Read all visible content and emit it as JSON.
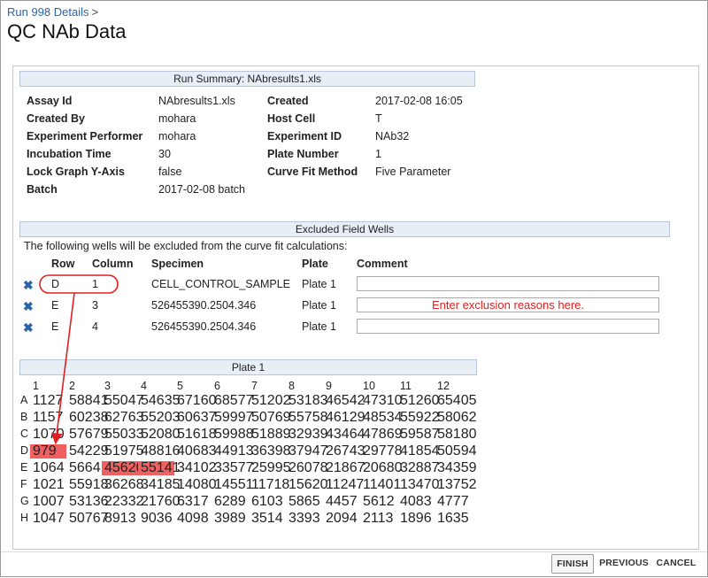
{
  "breadcrumb": {
    "label": "Run 998 Details",
    "sep": ">"
  },
  "page": {
    "title": "QC NAb Data"
  },
  "run_summary": {
    "title": "Run Summary: NAbresults1.xls",
    "left": [
      {
        "key": "Assay Id",
        "value": "NAbresults1.xls"
      },
      {
        "key": "Created By",
        "value": "mohara"
      },
      {
        "key": "Experiment Performer",
        "value": "mohara"
      },
      {
        "key": "Incubation Time",
        "value": "30"
      },
      {
        "key": "Lock Graph Y-Axis",
        "value": "false"
      },
      {
        "key": "Batch",
        "value": "2017-02-08 batch"
      }
    ],
    "right": [
      {
        "key": "Created",
        "value": "2017-02-08 16:05"
      },
      {
        "key": "Host Cell",
        "value": "T"
      },
      {
        "key": "Experiment ID",
        "value": "NAb32"
      },
      {
        "key": "Plate Number",
        "value": "1"
      },
      {
        "key": "Curve Fit Method",
        "value": "Five Parameter"
      }
    ]
  },
  "excluded": {
    "title": "Excluded Field Wells",
    "intro": "The following wells will be excluded from the curve fit calculations:",
    "headers": {
      "row": "Row",
      "column": "Column",
      "specimen": "Specimen",
      "plate": "Plate",
      "comment": "Comment"
    },
    "rows": [
      {
        "row": "D",
        "column": "1",
        "specimen": "CELL_CONTROL_SAMPLE",
        "plate": "Plate 1",
        "comment": "",
        "placeholder": ""
      },
      {
        "row": "E",
        "column": "3",
        "specimen": "526455390.2504.346",
        "plate": "Plate 1",
        "comment": "",
        "placeholder": "Enter exclusion reasons here."
      },
      {
        "row": "E",
        "column": "4",
        "specimen": "526455390.2504.346",
        "plate": "Plate 1",
        "comment": "",
        "placeholder": ""
      }
    ],
    "remove_icon": "close-x-icon",
    "accent": "#2a64a8",
    "highlight": "#f06060",
    "annotation_color": "#e02020"
  },
  "plate": {
    "title": "Plate 1",
    "columns": [
      "1",
      "2",
      "3",
      "4",
      "5",
      "6",
      "7",
      "8",
      "9",
      "10",
      "11",
      "12"
    ],
    "rows": [
      {
        "label": "A",
        "cells": [
          "1127",
          "58841",
          "55047",
          "54635",
          "67160",
          "68577",
          "51202",
          "53183",
          "46542",
          "47310",
          "51260",
          "65405"
        ]
      },
      {
        "label": "B",
        "cells": [
          "1157",
          "60238",
          "62763",
          "55203",
          "60637",
          "59997",
          "50769",
          "55758",
          "46129",
          "48534",
          "55922",
          "58062"
        ]
      },
      {
        "label": "C",
        "cells": [
          "1070",
          "57679",
          "55033",
          "52080",
          "51618",
          "59988",
          "51889",
          "32939",
          "43464",
          "47869",
          "59587",
          "58180"
        ]
      },
      {
        "label": "D",
        "cells": [
          "979",
          "54229",
          "51975",
          "48816",
          "40683",
          "44913",
          "36398",
          "37947",
          "26743",
          "29778",
          "41854",
          "50594"
        ]
      },
      {
        "label": "E",
        "cells": [
          "1064",
          "56641",
          "45620",
          "55141",
          "34102",
          "33577",
          "25995",
          "26078",
          "21867",
          "20680",
          "32887",
          "34359"
        ]
      },
      {
        "label": "F",
        "cells": [
          "1021",
          "55918",
          "36268",
          "34185",
          "14080",
          "14551",
          "11718",
          "15620",
          "11247",
          "11401",
          "13470",
          "13752"
        ]
      },
      {
        "label": "G",
        "cells": [
          "1007",
          "53136",
          "22332",
          "21760",
          "6317",
          "6289",
          "6103",
          "5865",
          "4457",
          "5612",
          "4083",
          "4777"
        ]
      },
      {
        "label": "H",
        "cells": [
          "1047",
          "50767",
          "8913",
          "9036",
          "4098",
          "3989",
          "3514",
          "3393",
          "2094",
          "2113",
          "1896",
          "1635"
        ]
      }
    ],
    "excluded_cells": [
      [
        "D",
        "1"
      ],
      [
        "E",
        "3"
      ],
      [
        "E",
        "4"
      ]
    ]
  },
  "buttons": {
    "finish": "FINISH",
    "previous": "PREVIOUS",
    "cancel": "CANCEL"
  }
}
